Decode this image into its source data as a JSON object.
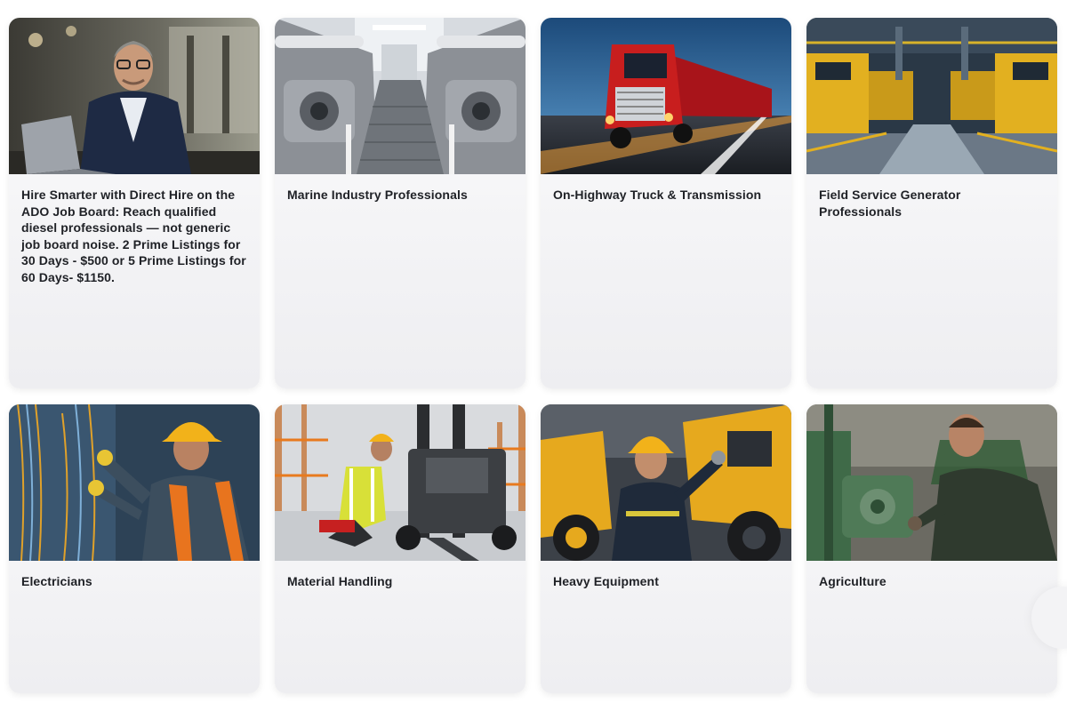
{
  "cards": [
    {
      "title": "Hire Smarter with Direct Hire on the ADO Job Board: Reach qualified diesel professionals — not generic job board noise. 2 Prime Listings for 30 Days - $500 or 5 Prime Listings for 60 Days- $1150."
    },
    {
      "title": "Marine Industry Professionals"
    },
    {
      "title": "On-Highway Truck & Transmission"
    },
    {
      "title": "Field Service Generator Professionals"
    },
    {
      "title": "Electricians"
    },
    {
      "title": "Material Handling"
    },
    {
      "title": "Heavy Equipment"
    },
    {
      "title": "Agriculture"
    }
  ],
  "colors": {
    "title_text": "#1f2126",
    "card_bg": "#f4f4f6",
    "accent_yellow": "#f2b21a",
    "truck_red": "#c81e1e"
  }
}
